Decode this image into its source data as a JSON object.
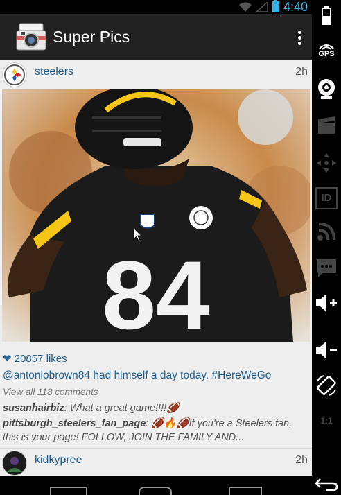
{
  "status_bar": {
    "time": "4:40",
    "icons": [
      "wifi-icon",
      "signal-icon",
      "battery-icon"
    ]
  },
  "action_bar": {
    "title": "Super Pics",
    "app_icon": "polaroid-camera-icon",
    "menu_icon": "overflow-menu-icon"
  },
  "posts": [
    {
      "user": "steelers",
      "time": "2h",
      "photo": {
        "jersey_number": "84"
      },
      "likes": "❤ 20857 likes",
      "caption": "@antoniobrown84 had himself a day today. #HereWeGo",
      "view_comments": "View all 118 comments",
      "comments": [
        {
          "user": "susanhairbiz",
          "text": ": What a great game!!!!🏈"
        },
        {
          "user": "pittsburgh_steelers_fan_page",
          "text": ": 🏈🔥🏈If you're a Steelers fan, this is your page! FOLLOW, JOIN THE FAMILY AND..."
        }
      ]
    },
    {
      "user": "kidkypree",
      "time": "2h"
    }
  ],
  "sidebar": {
    "gps_label": "GPS",
    "id_label": "ID",
    "scale_label": "1:1",
    "icons": [
      "battery-icon",
      "gps-icon",
      "webcam-icon",
      "clapperboard-icon",
      "dpad-icon",
      "id-icon",
      "rss-icon",
      "sms-icon",
      "volume-up-icon",
      "volume-down-icon",
      "rotate-icon",
      "scale-icon",
      "back-icon"
    ]
  },
  "colors": {
    "link": "#1f5f8f",
    "accent": "#33b5e5",
    "action_bar": "#222222"
  }
}
